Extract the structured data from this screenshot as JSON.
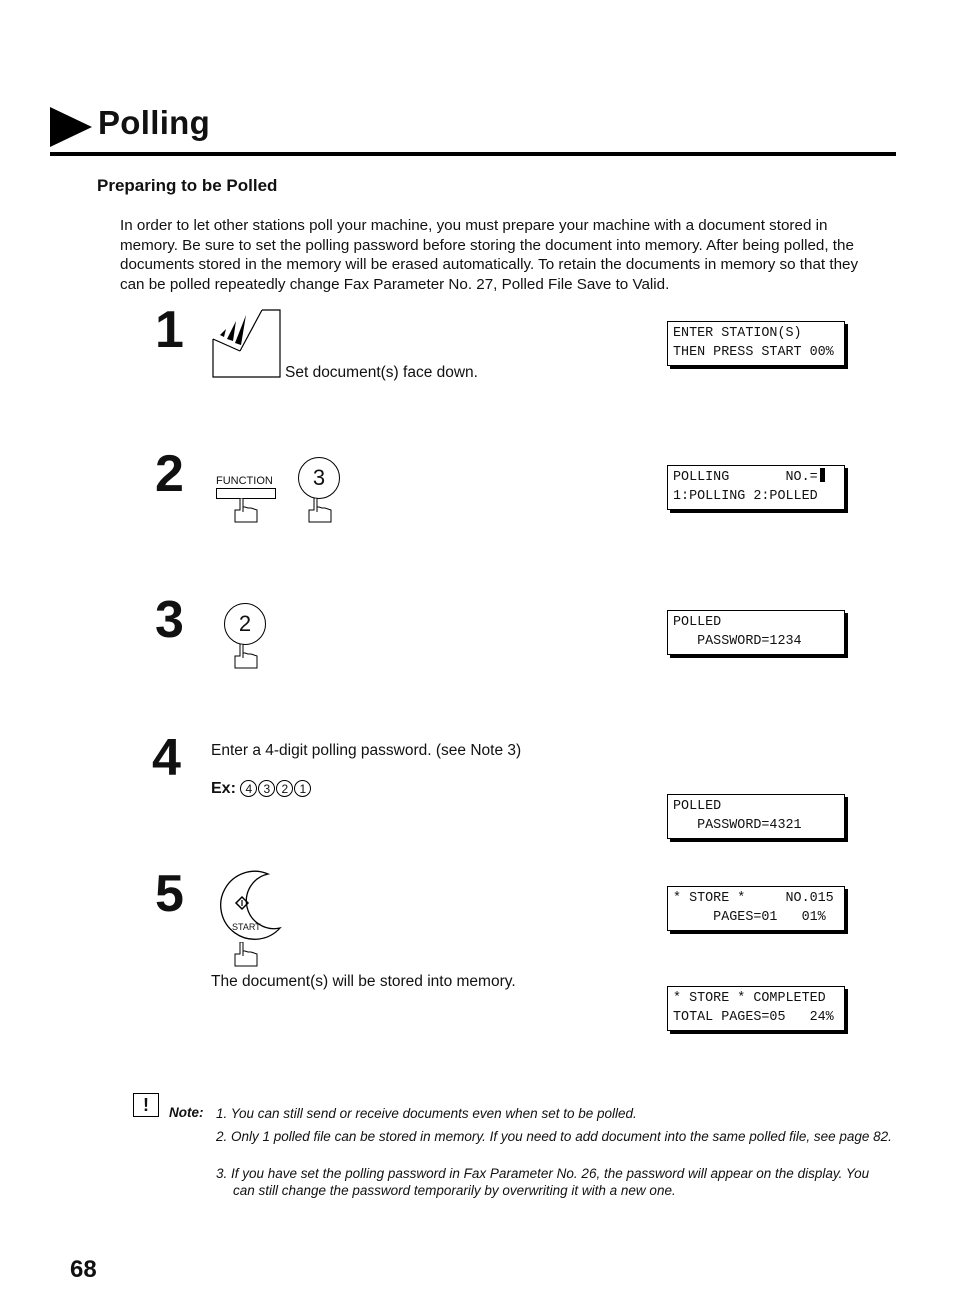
{
  "header": {
    "title": "Polling",
    "subtitle": "Preparing to be Polled"
  },
  "intro": "In order to let other stations poll your machine, you must prepare your machine with a document stored in memory.  Be sure to set the polling password before storing the document into memory.  After being polled, the documents stored in the memory will be erased automatically.  To retain the documents in memory so that they can be polled repeatedly change Fax Parameter No. 27, Polled File Save to Valid.",
  "steps": [
    {
      "number": "1",
      "text": "Set document(s) face down.",
      "icon": "document-feed-icon"
    },
    {
      "number": "2",
      "function_label": "FUNCTION",
      "key_label": "3",
      "icon": "press-finger-icon"
    },
    {
      "number": "3",
      "key_label": "2",
      "icon": "press-finger-icon"
    },
    {
      "number": "4",
      "text": "Enter a 4-digit polling password. (see Note 3)",
      "example_label": "Ex:",
      "example_keys": [
        "4",
        "3",
        "2",
        "1"
      ]
    },
    {
      "number": "5",
      "start_label": "START",
      "text": "The document(s) will be stored into memory.",
      "icon": "start-button-icon"
    }
  ],
  "displays": [
    {
      "line1": "ENTER STATION(S)",
      "line2": "THEN PRESS START 00%"
    },
    {
      "line1": "POLLING       NO.=",
      "line2": "1:POLLING 2:POLLED"
    },
    {
      "line1": "POLLED",
      "line2": "   PASSWORD=1234"
    },
    {
      "line1": "POLLED",
      "line2": "   PASSWORD=4321"
    },
    {
      "line1": "* STORE *     NO.015",
      "line2": "     PAGES=01   01%"
    },
    {
      "line1": "* STORE * COMPLETED",
      "line2": "TOTAL PAGES=05   24%"
    }
  ],
  "notes": {
    "label": "Note:",
    "items": [
      "1. You can still send or receive documents even when set to be polled.",
      "2. Only 1 polled file can be stored in memory. If you need to add document into the same polled file, see page 82.",
      "3. If you have set the polling password in Fax Parameter No. 26, the password will appear on the display. You can still change the password temporarily by overwriting it with a new one."
    ]
  },
  "page_number": "68"
}
